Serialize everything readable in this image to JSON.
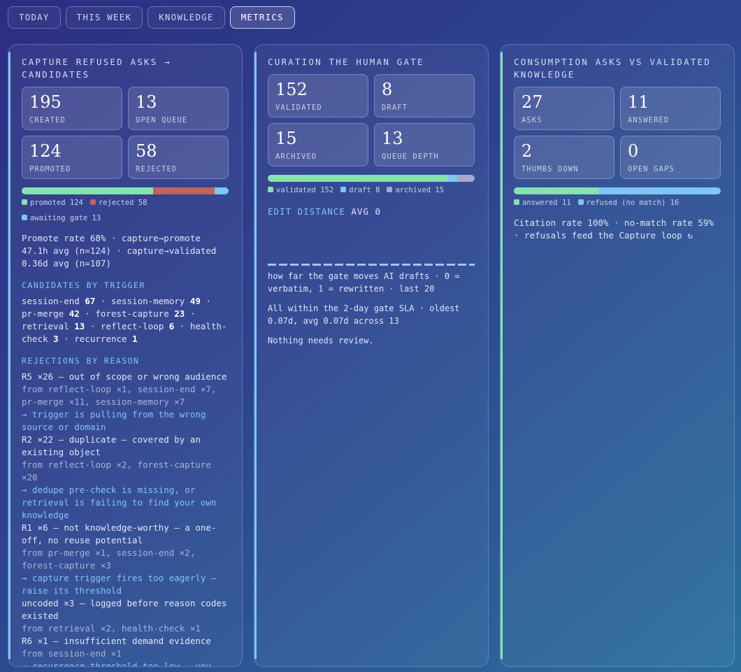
{
  "tabs": [
    {
      "label": "TODAY",
      "active": false
    },
    {
      "label": "THIS WEEK",
      "active": false
    },
    {
      "label": "KNOWLEDGE",
      "active": false
    },
    {
      "label": "METRICS",
      "active": true
    }
  ],
  "colors": {
    "green": "#86e3ad",
    "red": "#c0645c",
    "blue": "#7fc6f5",
    "gray": "#a3a8cc"
  },
  "capture": {
    "title": "CAPTURE REFUSED ASKS → CANDIDATES",
    "stats": [
      {
        "value": "195",
        "label": "CREATED"
      },
      {
        "value": "13",
        "label": "OPEN QUEUE"
      },
      {
        "value": "124",
        "label": "PROMOTED"
      },
      {
        "value": "58",
        "label": "REJECTED"
      }
    ],
    "bar": [
      {
        "label": "promoted 124",
        "value": 124,
        "color": "#86e3ad"
      },
      {
        "label": "rejected 58",
        "value": 58,
        "color": "#c0645c"
      },
      {
        "label": "awaiting gate 13",
        "value": 13,
        "color": "#7fc6f5"
      }
    ],
    "summary": "Promote rate 68% · capture→promote 47.1h avg (n=124) · capture→validated 0.36d avg (n=107)",
    "triggers_heading": "CANDIDATES BY TRIGGER",
    "triggers": [
      {
        "name": "session-end",
        "count": "67"
      },
      {
        "name": "session-memory",
        "count": "49"
      },
      {
        "name": "pr-merge",
        "count": "42"
      },
      {
        "name": "forest-capture",
        "count": "23"
      },
      {
        "name": "retrieval",
        "count": "13"
      },
      {
        "name": "reflect-loop",
        "count": "6"
      },
      {
        "name": "health-check",
        "count": "3"
      },
      {
        "name": "recurrence",
        "count": "1"
      }
    ],
    "rejections_heading": "REJECTIONS BY REASON",
    "rejections": [
      {
        "reason": "R5 ×26 — out of scope or wrong audience",
        "from": "from reflect-loop ×1, session-end ×7, pr-merge ×11, session-memory ×7",
        "advice": "→ trigger is pulling from the wrong source or domain"
      },
      {
        "reason": "R2 ×22 — duplicate — covered by an existing object",
        "from": "from reflect-loop ×2, forest-capture ×20",
        "advice": "→ dedupe pre-check is missing, or retrieval is failing to find your own knowledge"
      },
      {
        "reason": "R1 ×6 — not knowledge-worthy — a one-off, no reuse potential",
        "from": "from pr-merge ×1, session-end ×2, forest-capture ×3",
        "advice": "→ capture trigger fires too eagerly — raise its threshold"
      },
      {
        "reason": "uncoded ×3 — logged before reason codes existed",
        "from": "from retrieval ×2, health-check ×1",
        "advice": ""
      },
      {
        "reason": "R6 ×1 — insufficient demand evidence",
        "from": "from session-end ×1",
        "advice": "→ recurrence threshold too low — you are polishing content nothing asked for"
      }
    ]
  },
  "curation": {
    "title": "CURATION THE HUMAN GATE",
    "stats": [
      {
        "value": "152",
        "label": "VALIDATED"
      },
      {
        "value": "8",
        "label": "DRAFT"
      },
      {
        "value": "15",
        "label": "ARCHIVED"
      },
      {
        "value": "13",
        "label": "QUEUE DEPTH"
      }
    ],
    "bar": [
      {
        "label": "validated 152",
        "value": 152,
        "color": "#86e3ad"
      },
      {
        "label": "draft 8",
        "value": 8,
        "color": "#7fc6f5"
      },
      {
        "label": "archived 15",
        "value": 15,
        "color": "#a3a8cc"
      }
    ],
    "edit_key": "EDIT DISTANCE",
    "edit_value": "AVG 0",
    "edit_desc": "how far the gate moves AI drafts · 0 = verbatim, 1 = rewritten · last 20",
    "sla": "All within the 2-day gate SLA · oldest 0.07d, avg 0.07d across 13",
    "review": "Nothing needs review."
  },
  "consumption": {
    "title": "CONSUMPTION ASKS VS VALIDATED KNOWLEDGE",
    "stats": [
      {
        "value": "27",
        "label": "ASKS"
      },
      {
        "value": "11",
        "label": "ANSWERED"
      },
      {
        "value": "2",
        "label": "THUMBS DOWN"
      },
      {
        "value": "0",
        "label": "OPEN GAPS"
      }
    ],
    "bar": [
      {
        "label": "answered 11",
        "value": 11,
        "color": "#86e3ad"
      },
      {
        "label": "refused (no match) 16",
        "value": 16,
        "color": "#7fc6f5"
      }
    ],
    "summary": "Citation rate 100% · no-match rate 59% · refusals feed the Capture loop ↻"
  }
}
